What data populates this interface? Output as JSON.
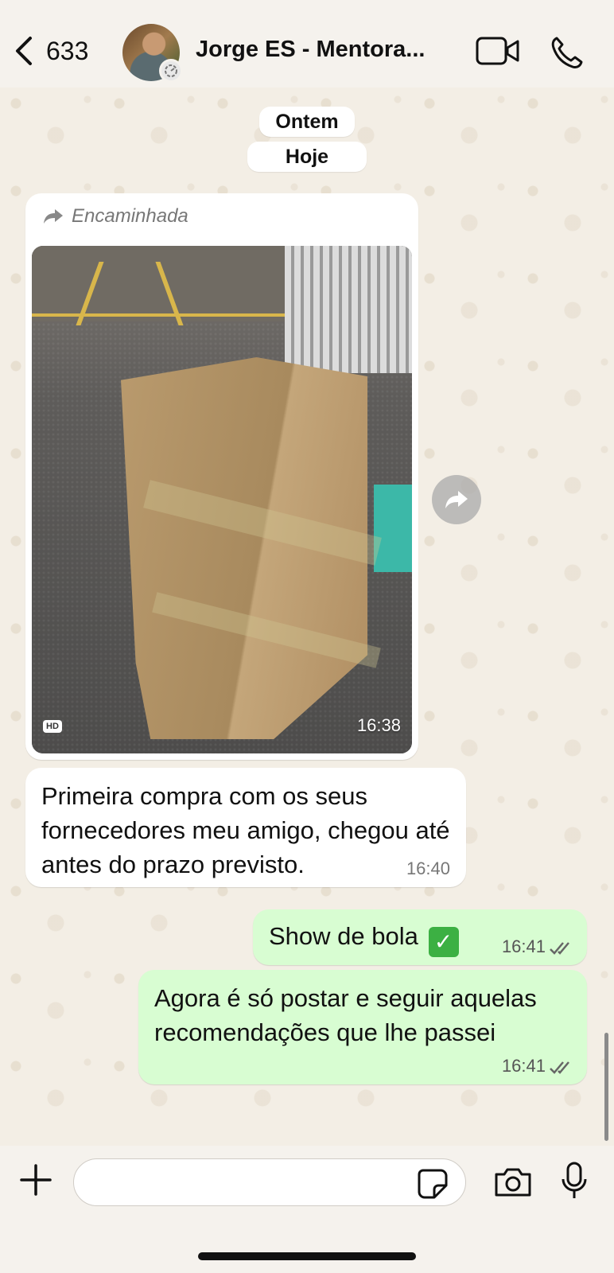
{
  "header": {
    "back_count": "633",
    "contact_name": "Jorge ES - Mentora...",
    "icons": [
      "chevron-left-icon",
      "video-call-icon",
      "phone-call-icon"
    ]
  },
  "dates": {
    "yesterday": "Ontem",
    "today": "Hoje"
  },
  "messages": {
    "forwarded": {
      "label": "Encaminhada",
      "quality": "HD",
      "time": "16:38"
    },
    "incoming_text": {
      "text": "Primeira compra com os seus fornecedores meu amigo, chegou até antes do prazo previsto.",
      "time": "16:40"
    },
    "outgoing_1": {
      "text": "Show de bola",
      "emoji": "✓",
      "time": "16:41"
    },
    "outgoing_2": {
      "text": "Agora é só postar e seguir aquelas recomendações que lhe passei",
      "time": "16:41"
    }
  },
  "composer": {
    "placeholder": ""
  },
  "colors": {
    "outgoing_bubble": "#d8fdd2",
    "incoming_bubble": "#ffffff",
    "wallpaper": "#f3eee5"
  }
}
